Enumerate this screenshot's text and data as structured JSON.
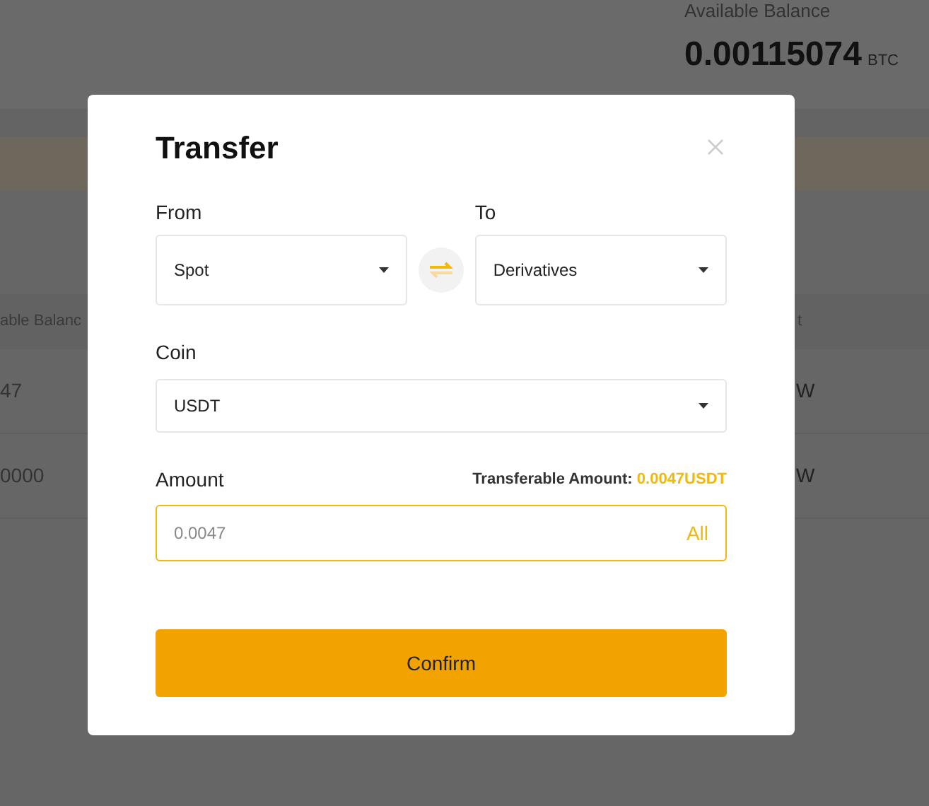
{
  "background": {
    "balance_label": "Available Balance",
    "balance_value": "0.00115074",
    "balance_unit": "BTC",
    "table": {
      "header": [
        "able Balanc",
        "t"
      ],
      "rows": [
        [
          "47",
          "W"
        ],
        [
          "0000",
          "W"
        ]
      ]
    }
  },
  "dialog": {
    "title": "Transfer",
    "from": {
      "label": "From",
      "value": "Spot"
    },
    "to": {
      "label": "To",
      "value": "Derivatives"
    },
    "coin": {
      "label": "Coin",
      "value": "USDT"
    },
    "amount": {
      "label": "Amount",
      "transferable_label": "Transferable Amount:",
      "transferable_value": "0.0047USDT",
      "placeholder": "0.0047",
      "all": "All"
    },
    "confirm": "Confirm"
  }
}
